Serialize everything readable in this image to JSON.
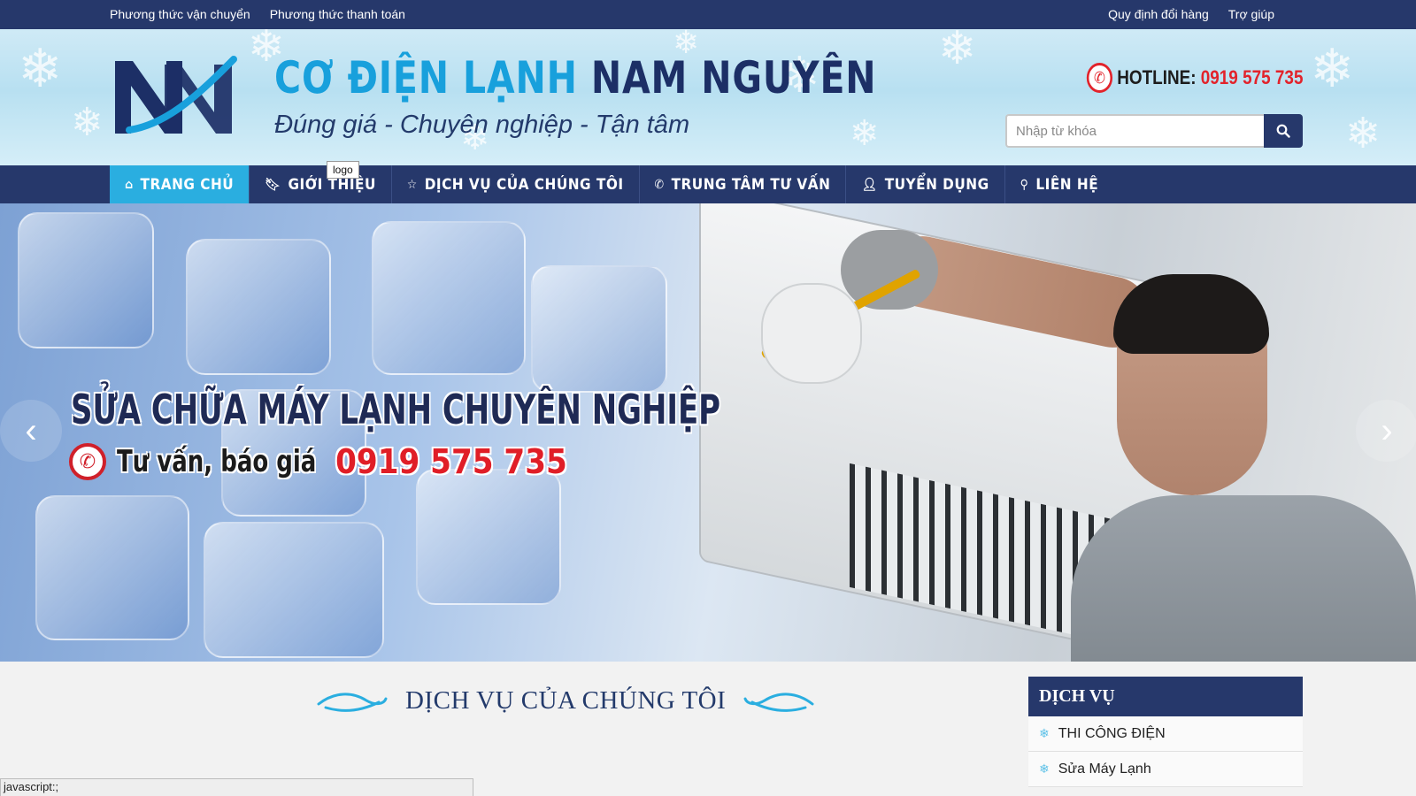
{
  "topbar": {
    "left_links": [
      "Phương thức vận chuyển",
      "Phương thức thanh toán"
    ],
    "right_links": [
      "Quy định đổi hàng",
      "Trợ giúp"
    ]
  },
  "header": {
    "logo_letters": "NN",
    "brand_title_part1": "CƠ ĐIỆN LẠNH",
    "brand_title_part2": "NAM NGUYÊN",
    "tagline": "Đúng giá - Chuyên nghiệp - Tận tâm",
    "hotline_label": "HOTLINE:",
    "hotline_number": "0919 575 735",
    "search_placeholder": "Nhập từ khóa"
  },
  "tooltip": "logo",
  "nav": {
    "items": [
      {
        "label": "TRANG CHỦ",
        "icon": "home-icon"
      },
      {
        "label": "GIỚI THIỆU",
        "icon": "bookmark-icon"
      },
      {
        "label": "DỊCH VỤ CỦA CHÚNG TÔI",
        "icon": "star-icon"
      },
      {
        "label": "TRUNG TÂM TƯ VẤN",
        "icon": "phone-icon"
      },
      {
        "label": "TUYỂN DỤNG",
        "icon": "user-add-icon"
      },
      {
        "label": "LIÊN HỆ",
        "icon": "map-marker-icon"
      }
    ],
    "active_index": 0
  },
  "slider": {
    "headline": "SỬA CHỮA MÁY LẠNH CHUYÊN NGHIỆP",
    "consult_text": "Tư vấn, báo giá",
    "phone": "0919 575 735"
  },
  "services": {
    "title": "DỊCH VỤ CỦA CHÚNG TÔI"
  },
  "sidebar": {
    "heading": "DỊCH VỤ",
    "items": [
      "THI CÔNG ĐIỆN",
      "Sửa Máy Lạnh"
    ]
  },
  "status_bar": "javascript:;",
  "colors": {
    "navy": "#26386b",
    "accent_blue": "#2aaee0",
    "red": "#e2232b"
  }
}
